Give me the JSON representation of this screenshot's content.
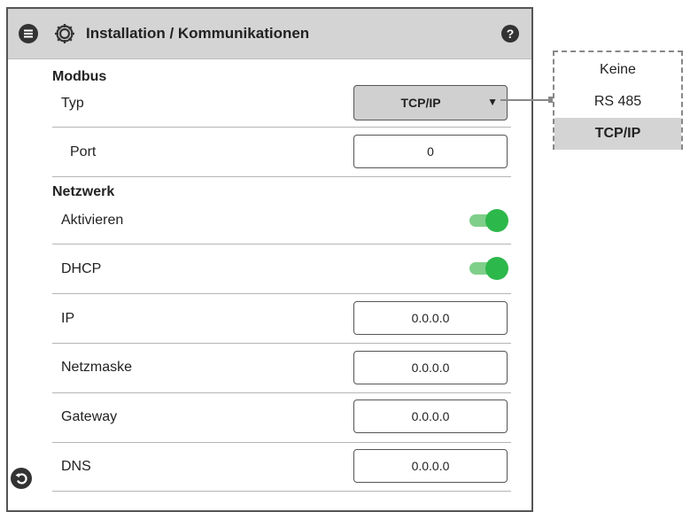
{
  "header": {
    "title": "Installation / Kommunikationen",
    "menu_icon": "menu-icon",
    "settings_icon": "gear-icon",
    "help_icon": "help-icon"
  },
  "modbus": {
    "section_title": "Modbus",
    "typ_label": "Typ",
    "typ_value": "TCP/IP",
    "port_label": "Port",
    "port_value": "0"
  },
  "netzwerk": {
    "section_title": "Netzwerk",
    "aktivieren_label": "Aktivieren",
    "aktivieren_on": true,
    "dhcp_label": "DHCP",
    "dhcp_on": true,
    "ip_label": "IP",
    "ip_value": "0.0.0.0",
    "netmask_label": "Netzmaske",
    "netmask_value": "0.0.0.0",
    "gateway_label": "Gateway",
    "gateway_value": "0.0.0.0",
    "dns_label": "DNS",
    "dns_value": "0.0.0.0"
  },
  "dropdown": {
    "options": [
      "Keine",
      "RS 485",
      "TCP/IP"
    ],
    "selected": "TCP/IP"
  },
  "footer": {
    "back_icon": "back-icon"
  },
  "colors": {
    "header_bg": "#d4d4d4",
    "toggle_on": "#2db84b",
    "toggle_track": "#7fcf8a",
    "selected_bg": "#d4d4d4"
  }
}
